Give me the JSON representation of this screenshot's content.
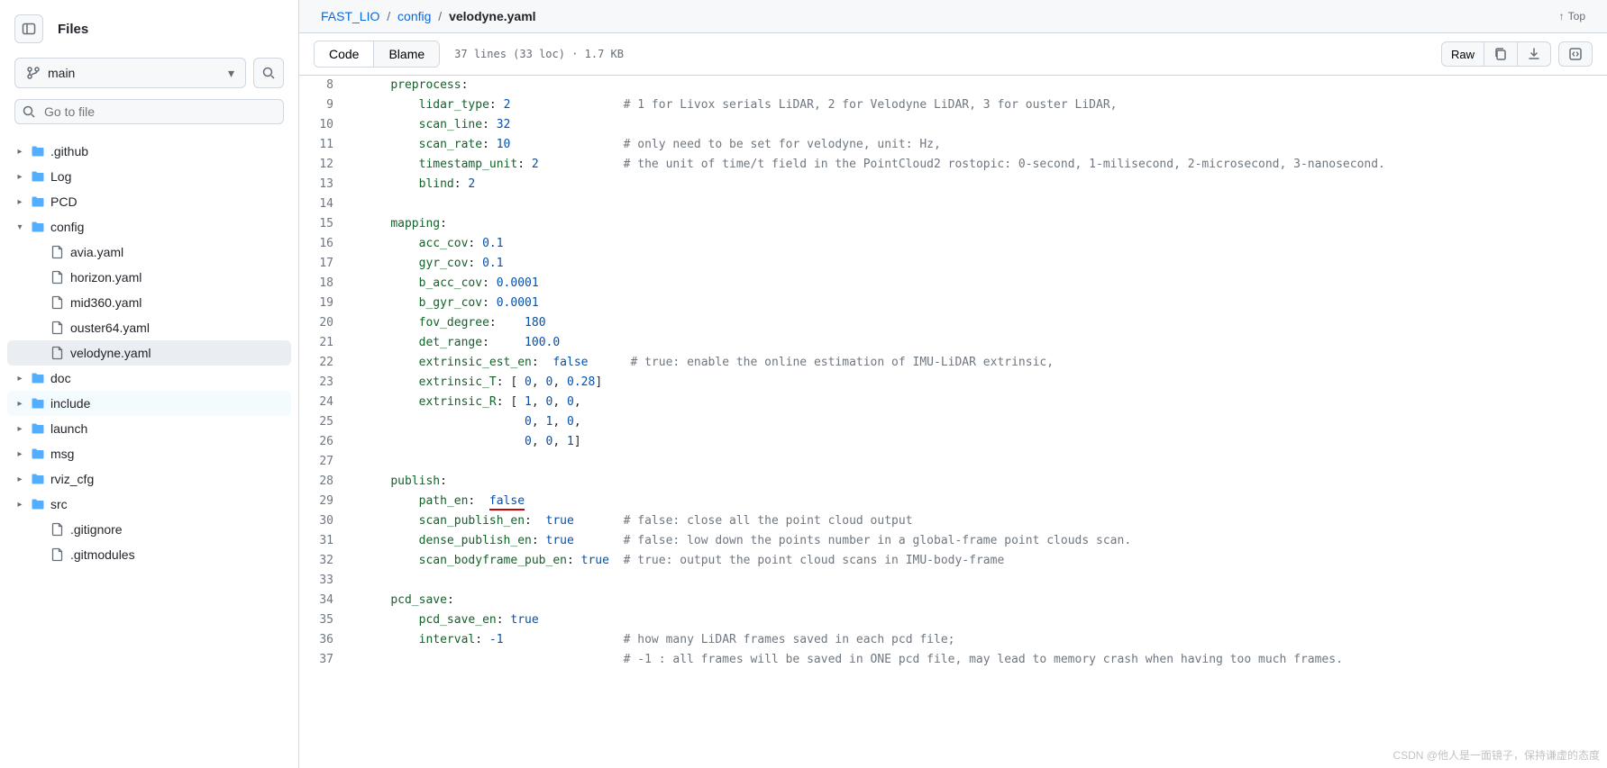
{
  "sidebar": {
    "title": "Files",
    "branch": "main",
    "goto_placeholder": "Go to file",
    "tree": [
      {
        "chev": "▸",
        "type": "folder",
        "name": ".github",
        "depth": 0
      },
      {
        "chev": "▸",
        "type": "folder",
        "name": "Log",
        "depth": 0
      },
      {
        "chev": "▸",
        "type": "folder",
        "name": "PCD",
        "depth": 0
      },
      {
        "chev": "▾",
        "type": "folder",
        "name": "config",
        "depth": 0,
        "open": true
      },
      {
        "chev": "",
        "type": "file",
        "name": "avia.yaml",
        "depth": 1
      },
      {
        "chev": "",
        "type": "file",
        "name": "horizon.yaml",
        "depth": 1
      },
      {
        "chev": "",
        "type": "file",
        "name": "mid360.yaml",
        "depth": 1
      },
      {
        "chev": "",
        "type": "file",
        "name": "ouster64.yaml",
        "depth": 1
      },
      {
        "chev": "",
        "type": "file",
        "name": "velodyne.yaml",
        "depth": 1,
        "selected": true
      },
      {
        "chev": "▸",
        "type": "folder",
        "name": "doc",
        "depth": 0
      },
      {
        "chev": "▸",
        "type": "folder",
        "name": "include",
        "depth": 0,
        "hl": true
      },
      {
        "chev": "▸",
        "type": "folder",
        "name": "launch",
        "depth": 0
      },
      {
        "chev": "▸",
        "type": "folder",
        "name": "msg",
        "depth": 0
      },
      {
        "chev": "▸",
        "type": "folder",
        "name": "rviz_cfg",
        "depth": 0
      },
      {
        "chev": "▸",
        "type": "folder",
        "name": "src",
        "depth": 0
      },
      {
        "chev": "",
        "type": "file",
        "name": ".gitignore",
        "depth": 1
      },
      {
        "chev": "",
        "type": "file",
        "name": ".gitmodules",
        "depth": 1
      }
    ]
  },
  "breadcrumb": {
    "root": "FAST_LIO",
    "mid": "config",
    "cur": "velodyne.yaml",
    "top": "Top"
  },
  "toolbar": {
    "code_tab": "Code",
    "blame_tab": "Blame",
    "meta": "37 lines (33 loc) · 1.7 KB",
    "raw": "Raw"
  },
  "code": [
    {
      "n": 8,
      "html": "    <span class='pl-ent'>preprocess</span>:"
    },
    {
      "n": 9,
      "html": "        <span class='pl-ent'>lidar_type</span>: <span class='pl-c1'>2</span>                <span class='pl-c'># 1 for Livox serials LiDAR, 2 for Velodyne LiDAR, 3 for ouster LiDAR, </span>"
    },
    {
      "n": 10,
      "html": "        <span class='pl-ent'>scan_line</span>: <span class='pl-c1'>32</span>"
    },
    {
      "n": 11,
      "html": "        <span class='pl-ent'>scan_rate</span>: <span class='pl-c1'>10</span>                <span class='pl-c'># only need to be set for velodyne, unit: Hz,</span>"
    },
    {
      "n": 12,
      "html": "        <span class='pl-ent'>timestamp_unit</span>: <span class='pl-c1'>2</span>            <span class='pl-c'># the unit of time/t field in the PointCloud2 rostopic: 0-second, 1-milisecond, 2-microsecond, 3-nanosecond.</span>"
    },
    {
      "n": 13,
      "html": "        <span class='pl-ent'>blind</span>: <span class='pl-c1'>2</span>"
    },
    {
      "n": 14,
      "html": ""
    },
    {
      "n": 15,
      "html": "    <span class='pl-ent'>mapping</span>:"
    },
    {
      "n": 16,
      "html": "        <span class='pl-ent'>acc_cov</span>: <span class='pl-c1'>0.1</span>"
    },
    {
      "n": 17,
      "html": "        <span class='pl-ent'>gyr_cov</span>: <span class='pl-c1'>0.1</span>"
    },
    {
      "n": 18,
      "html": "        <span class='pl-ent'>b_acc_cov</span>: <span class='pl-c1'>0.0001</span>"
    },
    {
      "n": 19,
      "html": "        <span class='pl-ent'>b_gyr_cov</span>: <span class='pl-c1'>0.0001</span>"
    },
    {
      "n": 20,
      "html": "        <span class='pl-ent'>fov_degree</span>:    <span class='pl-c1'>180</span>"
    },
    {
      "n": 21,
      "html": "        <span class='pl-ent'>det_range</span>:     <span class='pl-c1'>100.0</span>"
    },
    {
      "n": 22,
      "html": "        <span class='pl-ent'>extrinsic_est_en</span>:  <span class='pl-c1'>false</span>      <span class='pl-c'># true: enable the online estimation of IMU-LiDAR extrinsic,</span>"
    },
    {
      "n": 23,
      "html": "        <span class='pl-ent'>extrinsic_T</span>: [ <span class='pl-c1'>0</span>, <span class='pl-c1'>0</span>, <span class='pl-c1'>0.28</span>]"
    },
    {
      "n": 24,
      "html": "        <span class='pl-ent'>extrinsic_R</span>: [ <span class='pl-c1'>1</span>, <span class='pl-c1'>0</span>, <span class='pl-c1'>0</span>,"
    },
    {
      "n": 25,
      "html": "                       <span class='pl-c1'>0</span>, <span class='pl-c1'>1</span>, <span class='pl-c1'>0</span>,"
    },
    {
      "n": 26,
      "html": "                       <span class='pl-c1'>0</span>, <span class='pl-c1'>0</span>, <span class='pl-c1'>1</span>]"
    },
    {
      "n": 27,
      "html": ""
    },
    {
      "n": 28,
      "html": "    <span class='pl-ent'>publish</span>:"
    },
    {
      "n": 29,
      "html": "        <span class='pl-ent'>path_en</span>:  <span class='pl-c1' style='border-bottom:2px solid #cc0000;padding-bottom:1px'>false</span>"
    },
    {
      "n": 30,
      "html": "        <span class='pl-ent'>scan_publish_en</span>:  <span class='pl-c1'>true</span>       <span class='pl-c'># false: close all the point cloud output</span>"
    },
    {
      "n": 31,
      "html": "        <span class='pl-ent'>dense_publish_en</span>: <span class='pl-c1'>true</span>       <span class='pl-c'># false: low down the points number in a global-frame point clouds scan.</span>"
    },
    {
      "n": 32,
      "html": "        <span class='pl-ent'>scan_bodyframe_pub_en</span>: <span class='pl-c1'>true</span>  <span class='pl-c'># true: output the point cloud scans in IMU-body-frame</span>"
    },
    {
      "n": 33,
      "html": ""
    },
    {
      "n": 34,
      "html": "    <span class='pl-ent'>pcd_save</span>:"
    },
    {
      "n": 35,
      "html": "        <span class='pl-ent'>pcd_save_en</span>: <span class='pl-c1'>true</span>"
    },
    {
      "n": 36,
      "html": "        <span class='pl-ent'>interval</span>: <span class='pl-c1'>-1</span>                 <span class='pl-c'># how many LiDAR frames saved in each pcd file; </span>"
    },
    {
      "n": 37,
      "html": "                                     <span class='pl-c'># -1 : all frames will be saved in ONE pcd file, may lead to memory crash when having too much frames.</span>"
    }
  ],
  "watermark": "CSDN @他人是一面镜子，保持谦虚的态度"
}
